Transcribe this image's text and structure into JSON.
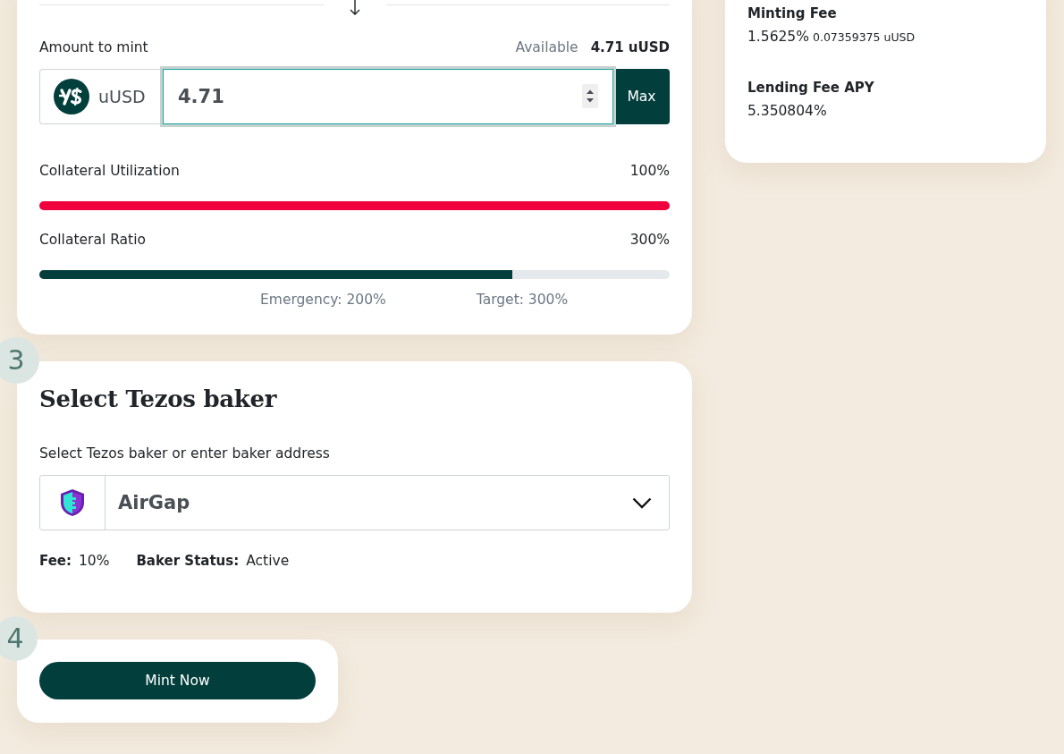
{
  "mint_panel": {
    "amount": {
      "label": "Amount to mint",
      "available_label": "Available",
      "available_value": "4.71 uUSD",
      "token": "uUSD",
      "value": "4.71",
      "max_button": "Max"
    },
    "meters": [
      {
        "label": "Collateral Utilization",
        "reading": "100%",
        "level": 1,
        "color": "#f0003c"
      },
      {
        "label": "Collateral Ratio",
        "reading": "300%",
        "level": 0.75,
        "color": "#023f3c",
        "markers": [
          "Emergency: 200%",
          "Target: 300%"
        ]
      }
    ]
  },
  "fees_panel": {
    "items": [
      {
        "label": "Minting Fee",
        "value": "1.5625%",
        "detail": "0.07359375 uUSD"
      },
      {
        "label": "Lending Fee APY",
        "value": "5.350804%"
      }
    ]
  },
  "baker_step": {
    "step": "3",
    "title": "Select Tezos baker",
    "field_label": "Select Tezos baker or enter baker address",
    "selected_baker": "AirGap",
    "fee_label": "Fee:",
    "fee_value": "10%",
    "status_label": "Baker Status:",
    "status_value": "Active"
  },
  "submit_step": {
    "step": "4",
    "button": "Mint Now"
  }
}
